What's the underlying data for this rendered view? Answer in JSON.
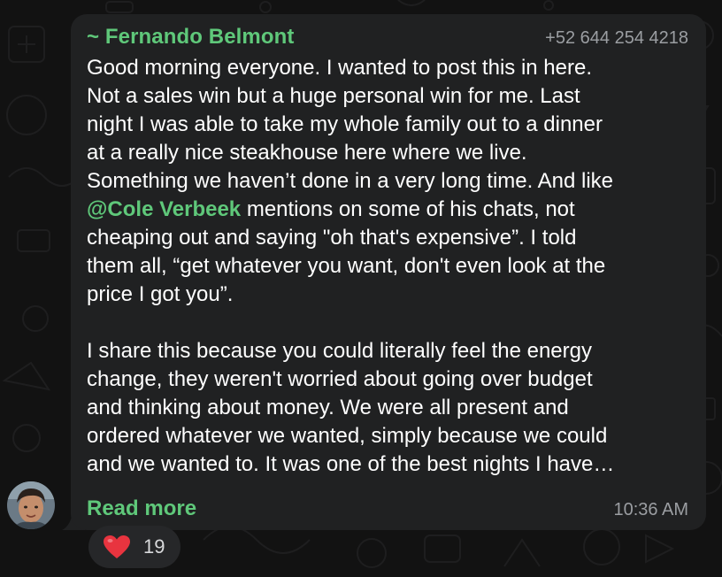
{
  "message": {
    "sender": "~ Fernando Belmont",
    "phone": "+52 644 254 4218",
    "text_before_mention": "Good morning everyone. I wanted to post this in here.\nNot a sales win but a huge personal win for me. Last\nnight I was able to take my whole family out to a dinner\nat a really nice steakhouse here where we live.\nSomething we haven’t done in a very long time. And like\n",
    "mention": "@Cole Verbeek",
    "text_after_mention": " mentions on some of his chats, not\ncheaping out and saying \"oh that's expensive”. I told\nthem all, “get whatever you want, don't even look at the\nprice I got you”.",
    "paragraph_2": "I share this because you could literally feel the energy\nchange, they weren't worried about going over budget\nand thinking about money. We were all present and\nordered whatever we wanted, simply because we could\nand we wanted to. It was one of the best nights I have…",
    "read_more_label": "Read more",
    "time": "10:36 AM"
  },
  "reaction": {
    "icon": "red-heart-icon",
    "count": "19"
  },
  "colors": {
    "background": "#121212",
    "bubble": "#202122",
    "accent_green": "#5fc87a",
    "muted_text": "#9b9ea2",
    "heart": "#e8343f"
  }
}
